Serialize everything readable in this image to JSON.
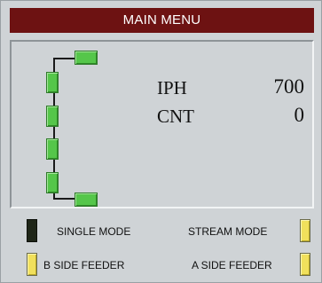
{
  "title": "MAIN MENU",
  "readouts": [
    {
      "label": "IPH",
      "value": "700"
    },
    {
      "label": "CNT",
      "value": "0"
    }
  ],
  "modes": {
    "single": {
      "label": "SINGLE MODE",
      "state": "off"
    },
    "stream": {
      "label": "STREAM MODE",
      "state": "on"
    },
    "b_feeder": {
      "label": "B SIDE FEEDER",
      "state": "on"
    },
    "a_feeder": {
      "label": "A SIDE FEEDER",
      "state": "on"
    }
  },
  "colors": {
    "title_bar": "#6d1212",
    "block_green": "#55c64a",
    "indicator_on": "#f1e05c",
    "indicator_off": "#1f2618",
    "panel": "#cfd3d6"
  }
}
